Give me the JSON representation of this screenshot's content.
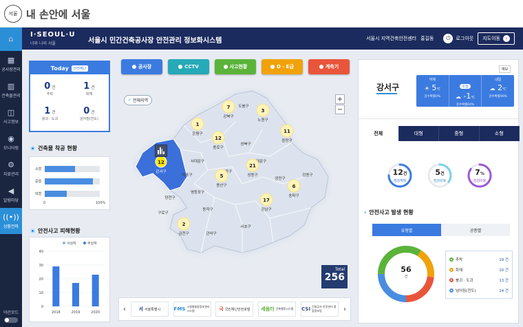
{
  "topbar": {
    "logo_text": "서울",
    "title": "내 손안에 서울"
  },
  "sidebar": {
    "items": [
      {
        "label": "공사장관리",
        "icon": "building-icon"
      },
      {
        "label": "건축물관리",
        "icon": "apartment-icon"
      },
      {
        "label": "사고정보",
        "icon": "car-icon"
      },
      {
        "label": "모니터링",
        "icon": "camera-icon"
      },
      {
        "label": "자료관리",
        "icon": "gear-icon"
      },
      {
        "label": "알림마당",
        "icon": "megaphone-icon"
      },
      {
        "label": "상황전파",
        "icon": "broadcast-icon"
      }
    ],
    "night_mode": "야간모드"
  },
  "header": {
    "brand": "I·SEOUL·U",
    "brand_sub": "너와 나의 서울",
    "title": "서울시 민간건축공사장 안전관리 정보화시스템",
    "org": "서울시 지역건축안전센터",
    "user": "홍길동",
    "logout": "로그아웃",
    "map_move": "지도이동"
  },
  "today": {
    "title": "Today",
    "tag": "안전재난",
    "stats": [
      {
        "value": "0",
        "unit": "건",
        "label": "추락"
      },
      {
        "value": "1",
        "unit": "건",
        "label": "화재"
      },
      {
        "value": "1",
        "unit": "건",
        "label": "붕괴 · 도괴"
      },
      {
        "value": "0",
        "unit": "건",
        "label": "넘어짐(전도)"
      }
    ]
  },
  "construction": {
    "title": "건축물 착공 현황",
    "bars": [
      {
        "label": "소형",
        "pct": 55
      },
      {
        "label": "중형",
        "pct": 88
      },
      {
        "label": "대형",
        "pct": 40
      }
    ],
    "axis_min": "0",
    "axis_max": "100%"
  },
  "damage": {
    "title": "안전사고 피해현황",
    "legend": [
      "사상자",
      "부상자"
    ],
    "yticks": [
      "40",
      "30",
      "20",
      "10",
      "0"
    ],
    "ymax": 40,
    "categories": [
      "2018",
      "2019",
      "2020"
    ],
    "values": [
      29,
      17,
      23
    ]
  },
  "categories": [
    {
      "label": "공사장",
      "color": "#3b7be0"
    },
    {
      "label": "CCTV",
      "color": "#26a9b8"
    },
    {
      "label": "사고현황",
      "color": "#5bb33a"
    },
    {
      "label": "D - E급",
      "color": "#f0a20a"
    },
    {
      "label": "계측기",
      "color": "#e9553a"
    }
  ],
  "map": {
    "all_regions": "전체지역",
    "zoom_in": "+",
    "zoom_out": "−",
    "districts": [
      {
        "name": "도봉구",
        "count": ""
      },
      {
        "name": "강북구",
        "count": "7"
      },
      {
        "name": "노원구",
        "count": "3"
      },
      {
        "name": "은평구",
        "count": "1"
      },
      {
        "name": "성북구",
        "count": ""
      },
      {
        "name": "중랑구",
        "count": "11"
      },
      {
        "name": "종로구",
        "count": "12"
      },
      {
        "name": "동대문구",
        "count": ""
      },
      {
        "name": "강서구",
        "count": "12"
      },
      {
        "name": "서대문구",
        "count": ""
      },
      {
        "name": "중구",
        "count": ""
      },
      {
        "name": "성동구",
        "count": "21"
      },
      {
        "name": "광진구",
        "count": ""
      },
      {
        "name": "강동구",
        "count": ""
      },
      {
        "name": "마포구",
        "count": ""
      },
      {
        "name": "용산구",
        "count": "5"
      },
      {
        "name": "양천구",
        "count": ""
      },
      {
        "name": "영등포구",
        "count": ""
      },
      {
        "name": "동작구",
        "count": ""
      },
      {
        "name": "송파구",
        "count": "6"
      },
      {
        "name": "강남구",
        "count": "17"
      },
      {
        "name": "구로구",
        "count": ""
      },
      {
        "name": "금천구",
        "count": "2"
      },
      {
        "name": "관악구",
        "count": ""
      },
      {
        "name": "서초구",
        "count": ""
      }
    ],
    "total_label": "Total",
    "total_value": "256"
  },
  "partners": [
    {
      "mark": "서",
      "name": "서울특별시"
    },
    {
      "mark": "FMS",
      "name": "시설물통합정보관리시스템"
    },
    {
      "mark": "국",
      "name": "국민재난안전포털"
    },
    {
      "mark": "세움터",
      "name": "건축행정시스템"
    },
    {
      "mark": "CSI",
      "name": "건설공사 안전관리 종합정보망"
    }
  ],
  "district_panel": {
    "name": "강서구",
    "weather_tag": "예보",
    "weather": [
      {
        "day": "어제",
        "icon": "sun-icon",
        "temp": "5",
        "unit": "℃",
        "rain": "강수확률0%"
      },
      {
        "day": "오늘",
        "icon": "cloud-icon",
        "temp": "-1",
        "unit": "℃",
        "rain": "강수확률60%"
      },
      {
        "day": "내일",
        "icon": "cloud-icon",
        "temp": "2",
        "unit": "℃",
        "rain": "강수확률90%"
      }
    ],
    "tabs": [
      "전체",
      "대형",
      "중형",
      "소형"
    ],
    "rings": [
      {
        "value": "12",
        "unit": "건",
        "label": "점검계획",
        "color": "#3b7be0",
        "fraction": 0.75
      },
      {
        "value": "5",
        "unit": "건",
        "label": "점검완료",
        "color": "#7ad0e8",
        "fraction": 0.35
      },
      {
        "value": "7",
        "unit": "%",
        "label": "점검비율",
        "color": "#9b59d6",
        "fraction": 0.85
      }
    ],
    "accident_title": "안전사고 발생 현황",
    "subtabs": [
      "유형별",
      "공종별"
    ],
    "donut_total": "56",
    "donut_unit": "건",
    "accidents": [
      {
        "name": "추락",
        "count": "19 건",
        "value": 19,
        "color": "#5bb33a"
      },
      {
        "name": "화재",
        "count": "10 건",
        "value": 10,
        "color": "#f0a20a"
      },
      {
        "name": "붕괴 · 도괴",
        "count": "13 건",
        "value": 13,
        "color": "#e9553a"
      },
      {
        "name": "넘어짐(전도)",
        "count": "14 건",
        "value": 14,
        "color": "#4a8de0"
      }
    ]
  }
}
